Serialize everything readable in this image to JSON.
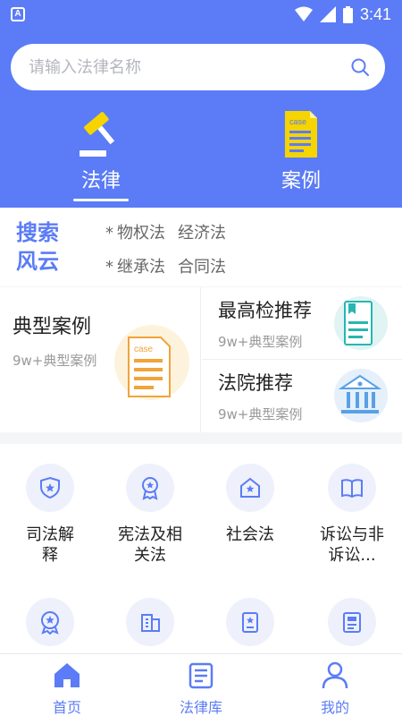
{
  "status_bar": {
    "time": "3:41",
    "app_icon_letter": "A",
    "icons": [
      "wifi-icon",
      "signal-icon",
      "battery-icon"
    ]
  },
  "search": {
    "placeholder": "请输入法律名称"
  },
  "tabs": [
    {
      "label": "法律",
      "icon": "gavel-icon",
      "active": true
    },
    {
      "label": "案例",
      "icon": "case-document-icon",
      "active": false
    }
  ],
  "hot_search": {
    "title": "搜索风云",
    "rows": [
      {
        "prefix": "*",
        "items": [
          "物权法",
          "经济法"
        ]
      },
      {
        "prefix": "*",
        "items": [
          "继承法",
          "合同法"
        ]
      }
    ]
  },
  "cards": {
    "typical": {
      "title": "典型案例",
      "subtitle": "9w+典型案例",
      "icon": "case-document-icon"
    },
    "procuratorate": {
      "title": "最高检推荐",
      "subtitle": "9w+典型案例",
      "icon": "bookmark-document-icon"
    },
    "court": {
      "title": "法院推荐",
      "subtitle": "9w+典型案例",
      "icon": "courthouse-icon"
    }
  },
  "categories": [
    {
      "label": "司法解释",
      "icon": "shield-star-icon"
    },
    {
      "label": "宪法及相关法",
      "icon": "medal-star-icon"
    },
    {
      "label": "社会法",
      "icon": "house-star-icon"
    },
    {
      "label": "诉讼与非诉讼...",
      "icon": "open-book-icon"
    },
    {
      "label": "",
      "icon": "badge-star-icon"
    },
    {
      "label": "",
      "icon": "building-icon"
    },
    {
      "label": "",
      "icon": "certificate-star-icon"
    },
    {
      "label": "",
      "icon": "document-list-icon"
    }
  ],
  "bottom_nav": [
    {
      "label": "首页",
      "icon": "home-icon",
      "active": true
    },
    {
      "label": "法律库",
      "icon": "law-library-icon",
      "active": false
    },
    {
      "label": "我的",
      "icon": "user-icon",
      "active": false
    }
  ],
  "colors": {
    "primary": "#5b7cf6",
    "case_icon_yellow": "#f5d400",
    "card_icon_orange": "#f0a43a",
    "card_icon_teal": "#28b6b0"
  }
}
